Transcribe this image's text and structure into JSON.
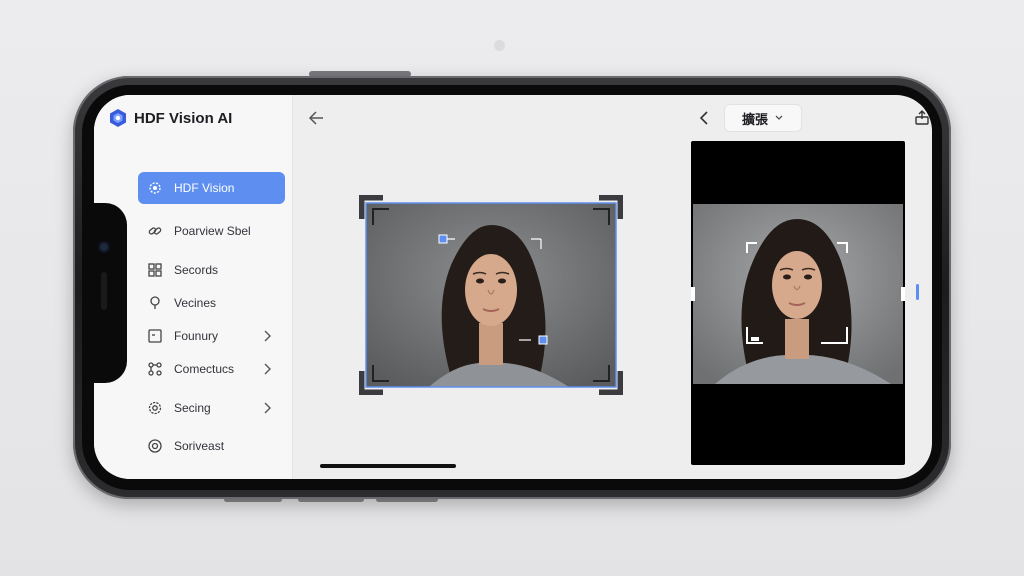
{
  "app": {
    "name": "HDF Vision AI"
  },
  "sidebar": {
    "items": [
      {
        "label": "HDF Vision",
        "icon": "gear-sparkle-icon",
        "active": true,
        "has_chevron": false
      },
      {
        "label": "Poarview Sbel",
        "icon": "link-icon",
        "active": false,
        "has_chevron": false
      },
      {
        "label": "Secords",
        "icon": "grid-icon",
        "active": false,
        "has_chevron": false
      },
      {
        "label": "Vecines",
        "icon": "pin-icon",
        "active": false,
        "has_chevron": false
      },
      {
        "label": "Founury",
        "icon": "frame-icon",
        "active": false,
        "has_chevron": true
      },
      {
        "label": "Comectucs",
        "icon": "nodes-icon",
        "active": false,
        "has_chevron": true
      },
      {
        "label": "Secing",
        "icon": "settings-icon",
        "active": false,
        "has_chevron": true
      },
      {
        "label": "Soriveast",
        "icon": "circle-icon",
        "active": false,
        "has_chevron": false
      }
    ]
  },
  "toolbar": {
    "language_label": "擴張",
    "icons": [
      "back-icon",
      "chevron-left-icon",
      "share-icon",
      "camera-icon",
      "send-icon"
    ]
  },
  "colors": {
    "accent": "#5e8ff0",
    "sidebar_bg": "#f7f7f8",
    "screen_bg": "#eeeeef"
  }
}
